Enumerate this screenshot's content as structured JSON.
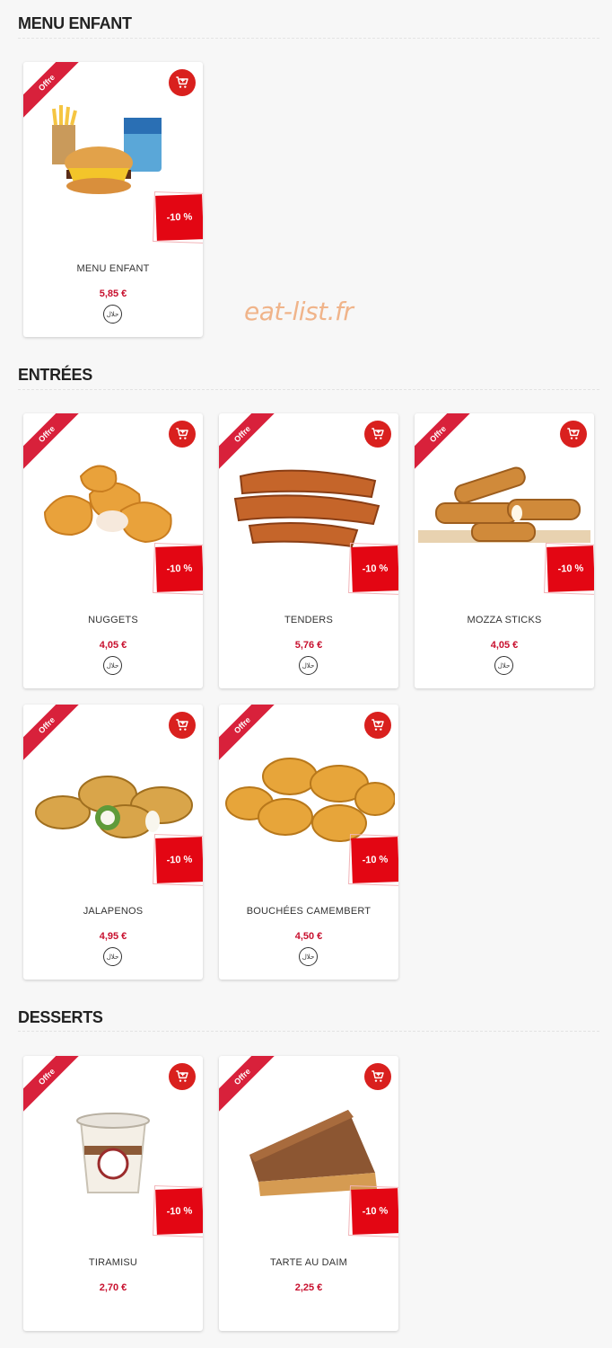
{
  "sections": [
    {
      "title": "MENU ENFANT"
    },
    {
      "title": "ENTRÉES"
    },
    {
      "title": "DESSERTS"
    }
  ],
  "offer_label": "Offre",
  "discount_label": "-10 %",
  "halal_label": "حلال",
  "watermark": "eat-list.fr",
  "products": [
    {
      "name": "MENU ENFANT",
      "price": "5,85 €",
      "image": "kids-menu-burger-fries-drink-image",
      "halal": true
    },
    {
      "name": "NUGGETS",
      "price": "4,05 €",
      "image": "nuggets-image",
      "halal": true
    },
    {
      "name": "TENDERS",
      "price": "5,76 €",
      "image": "tenders-image",
      "halal": true
    },
    {
      "name": "MOZZA STICKS",
      "price": "4,05 €",
      "image": "mozza-sticks-image",
      "halal": true
    },
    {
      "name": "JALAPENOS",
      "price": "4,95 €",
      "image": "jalapenos-image",
      "halal": true
    },
    {
      "name": "BOUCHÉES CAMEMBERT",
      "price": "4,50 €",
      "image": "camembert-bites-image",
      "halal": true
    },
    {
      "name": "TIRAMISU",
      "price": "2,70 €",
      "image": "tiramisu-cup-image",
      "halal": false
    },
    {
      "name": "TARTE AU DAIM",
      "price": "2,25 €",
      "image": "daim-tart-slice-image",
      "halal": false
    }
  ],
  "colors": {
    "accent": "#d9201e",
    "price": "#c8102e",
    "ribbon": "#d8213b"
  }
}
